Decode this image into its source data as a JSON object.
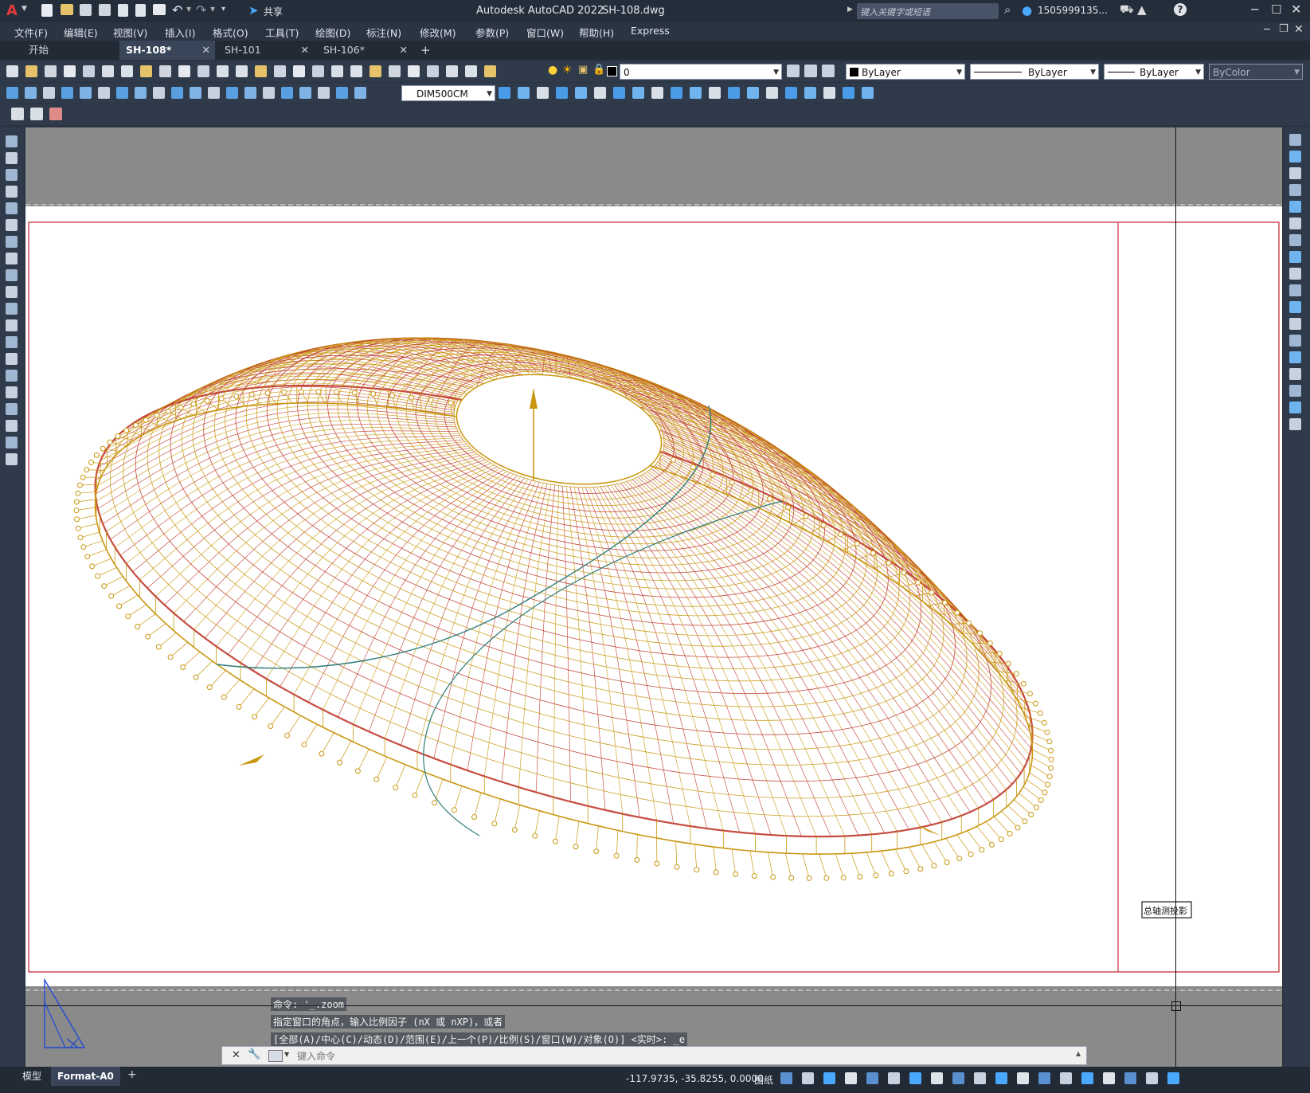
{
  "window": {
    "title": "Autodesk AutoCAD 2022",
    "file": "SH-108.dwg"
  },
  "quick_access": {
    "share_label": "共享"
  },
  "search": {
    "placeholder": "键入关键字或短语"
  },
  "user": {
    "name": "1505999135..."
  },
  "menu": [
    "文件(F)",
    "编辑(E)",
    "视图(V)",
    "插入(I)",
    "格式(O)",
    "工具(T)",
    "绘图(D)",
    "标注(N)",
    "修改(M)",
    "参数(P)",
    "窗口(W)",
    "帮助(H)",
    "Express"
  ],
  "tabs": [
    {
      "label": "开始"
    },
    {
      "label": "SH-108*"
    },
    {
      "label": "SH-101"
    },
    {
      "label": "SH-106*"
    }
  ],
  "properties": {
    "layer": "0",
    "color": "ByLayer",
    "linetype": "ByLayer",
    "lineweight": "ByLayer",
    "plotstyle": "ByColor",
    "dimstyle": "DIM500CM"
  },
  "drawing": {
    "stamp_text": "总轴测投影",
    "colors": {
      "structure": "#c9960f",
      "members": "#c0392b",
      "curve": "#2e7d7a",
      "frame": "#cc2f3c"
    }
  },
  "command": {
    "history": [
      "命令: '_.zoom",
      "指定窗口的角点，输入比例因子 (nX 或 nXP)，或者",
      "[全部(A)/中心(C)/动态(D)/范围(E)/上一个(P)/比例(S)/窗口(W)/对象(O)] <实时>: _e"
    ],
    "placeholder": "键入命令"
  },
  "layout_tabs": [
    "模型",
    "Format-A0"
  ],
  "status": {
    "coords": "-117.9735, -35.8255, 0.0000",
    "space": "图纸"
  }
}
